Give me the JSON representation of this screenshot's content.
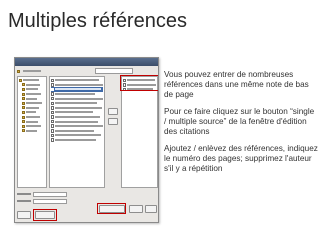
{
  "slide": {
    "title": "Multiples références",
    "paragraphs": [
      "Vous pouvez entrer de nombreuses références dans une même note de bas de page",
      "Pour ce faire cliquez sur le bouton “single / multiple source” de la fenêtre d'édition des citations",
      "Ajoutez / enlèvez des références, indiquez le numéro des pages; supprimez l'auteur s'il y a répétition"
    ]
  },
  "colors": {
    "highlight": "#c00000",
    "selection": "#3f6aa8",
    "titlebar": "#3b4d69"
  }
}
